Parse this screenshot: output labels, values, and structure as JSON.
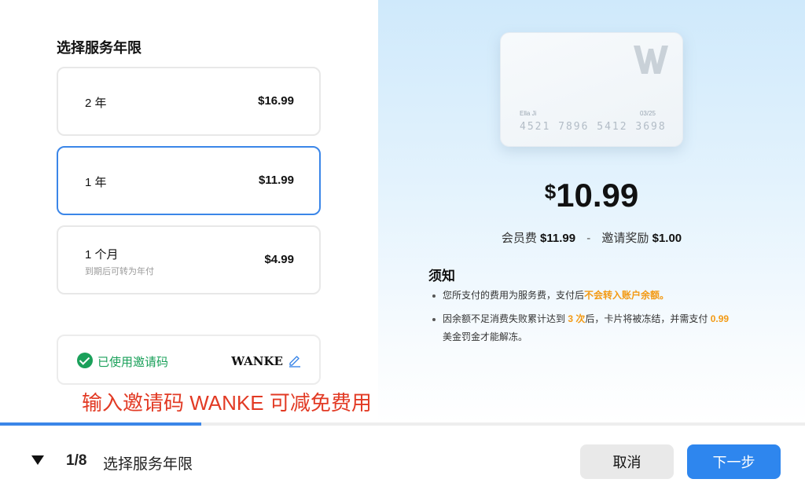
{
  "plan_section": {
    "title": "选择服务年限",
    "plans": [
      {
        "name": "2 年",
        "price": "$16.99",
        "sub": "",
        "selected": false
      },
      {
        "name": "1 年",
        "price": "$11.99",
        "sub": "",
        "selected": true
      },
      {
        "name": "1 个月",
        "price": "$4.99",
        "sub": "到期后可转为年付",
        "selected": false
      }
    ]
  },
  "invite": {
    "status": "已使用邀请码",
    "code": "WANKE",
    "check_icon": "check-circle-icon",
    "edit_icon": "pencil-icon"
  },
  "promo_text": "输入邀请码 WANKE 可减免费用",
  "card": {
    "holder": "Ella Ji",
    "expiry": "03/25",
    "number": "4521 7896 5412 3698",
    "logo": "W"
  },
  "summary": {
    "currency": "$",
    "total": "10.99",
    "fee_label": "会员费",
    "fee_value": "$11.99",
    "separator": "-",
    "reward_label": "邀请奖励",
    "reward_value": "$1.00"
  },
  "notice": {
    "title": "须知",
    "item1_prefix": "您所支付的费用为服务费，支付后",
    "item1_highlight": "不会转入账户余额。",
    "item2_prefix": "因余额不足消费失败累计达到 ",
    "item2_highlight_count": "3 次",
    "item2_middle": "后，卡片将被冻结，并需支付 ",
    "item2_highlight_amount": "0.99",
    "item2_suffix": "美金罚金才能解冻。"
  },
  "progress": {
    "current": 1,
    "total": 8,
    "fraction": 0.25
  },
  "footer": {
    "step_count": "1/8",
    "step_name": "选择服务年限",
    "cancel_label": "取消",
    "next_label": "下一步"
  },
  "colors": {
    "accent": "#2e86ee",
    "selected_border": "#3b86e8",
    "success": "#1aa05a",
    "highlight": "#f39a14",
    "promo": "#e23a24"
  }
}
